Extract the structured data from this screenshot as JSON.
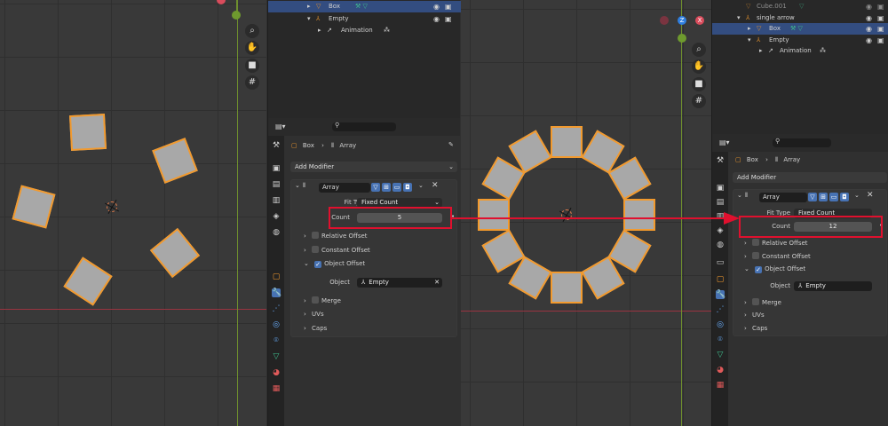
{
  "left": {
    "outliner": [
      {
        "label": "Box",
        "selected": true,
        "icon": "mesh-icon",
        "indent": 1
      },
      {
        "label": "Empty",
        "selected": false,
        "icon": "empty-icon",
        "indent": 1
      },
      {
        "label": "Animation",
        "selected": false,
        "icon": "animation-icon",
        "indent": 2
      }
    ],
    "breadcrumb": {
      "object": "Box",
      "modifier": "Array"
    },
    "add_modifier": "Add Modifier",
    "modifier": {
      "name": "Array",
      "fit_type_label": "Fit Type",
      "fit_type_value": "Fixed Count",
      "count_label": "Count",
      "count_value": "5",
      "relative_offset": "Relative Offset",
      "constant_offset": "Constant Offset",
      "object_offset": "Object Offset",
      "object_label": "Object",
      "object_value": "Empty",
      "merge": "Merge",
      "uvs": "UVs",
      "caps": "Caps"
    }
  },
  "right": {
    "outliner": [
      {
        "label": "Cube.001",
        "selected": false,
        "icon": "mesh-icon",
        "indent": 1
      },
      {
        "label": "single arrow",
        "selected": false,
        "icon": "empty-icon",
        "indent": 0
      },
      {
        "label": "Box",
        "selected": true,
        "icon": "mesh-icon",
        "indent": 1
      },
      {
        "label": "Empty",
        "selected": false,
        "icon": "empty-icon",
        "indent": 1
      },
      {
        "label": "Animation",
        "selected": false,
        "icon": "animation-icon",
        "indent": 2
      }
    ],
    "breadcrumb": {
      "object": "Box",
      "modifier": "Array"
    },
    "add_modifier": "Add Modifier",
    "modifier": {
      "name": "Array",
      "fit_type_label": "Fit Type",
      "fit_type_value": "Fixed Count",
      "count_label": "Count",
      "count_value": "12",
      "relative_offset": "Relative Offset",
      "constant_offset": "Constant Offset",
      "object_offset": "Object Offset",
      "object_label": "Object",
      "object_value": "Empty",
      "merge": "Merge",
      "uvs": "UVs",
      "caps": "Caps"
    }
  },
  "gizmo_labels": {
    "z": "Z",
    "x": "X"
  },
  "colors": {
    "accent": "#4772b3",
    "selection": "#f29a2e",
    "highlight": "#e0102e",
    "x_axis": "#9a3440",
    "y_axis": "#6e8f2e"
  },
  "left_array_count": 5,
  "right_array_count": 12
}
